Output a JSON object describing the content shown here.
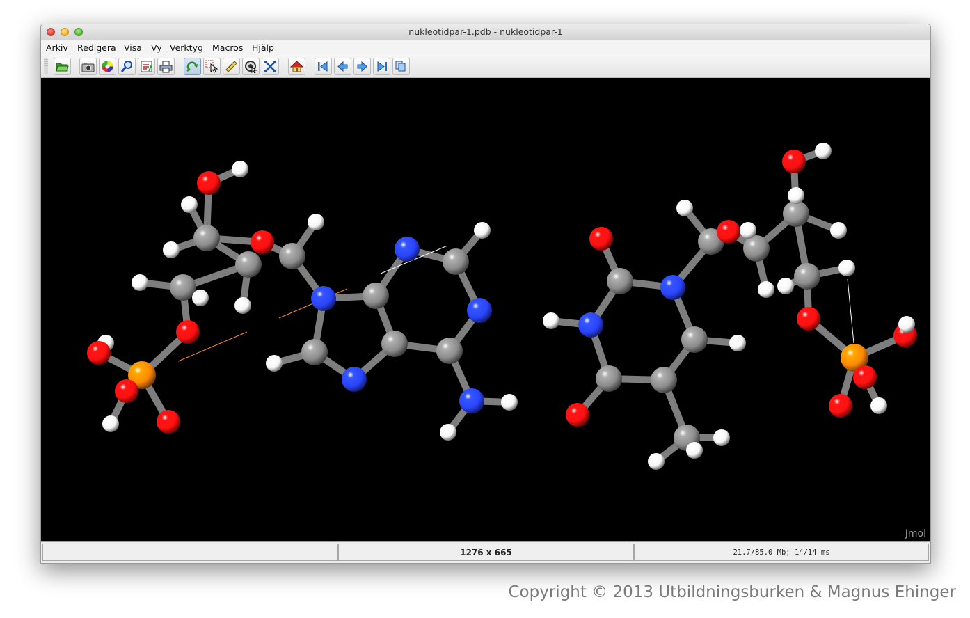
{
  "window": {
    "title": "nukleotidpar-1.pdb - nukleotidpar-1"
  },
  "menubar": {
    "items": [
      {
        "label": "Arkiv"
      },
      {
        "label": "Redigera"
      },
      {
        "label": "Visa"
      },
      {
        "label": "Vy"
      },
      {
        "label": "Verktyg"
      },
      {
        "label": "Macros"
      },
      {
        "label": "Hjälp"
      }
    ]
  },
  "toolbar": {
    "buttons": [
      {
        "icon": "open-folder-icon"
      },
      {
        "icon": "camera-icon"
      },
      {
        "icon": "color-wheel-icon"
      },
      {
        "icon": "magnifier-icon"
      },
      {
        "icon": "script-editor-icon"
      },
      {
        "icon": "print-icon"
      },
      {
        "icon": "rotate-icon",
        "active": true
      },
      {
        "icon": "select-pointer-icon"
      },
      {
        "icon": "ruler-icon"
      },
      {
        "icon": "pick-center-icon"
      },
      {
        "icon": "move-atoms-icon"
      },
      {
        "icon": "home-icon"
      },
      {
        "icon": "first-frame-icon"
      },
      {
        "icon": "previous-frame-icon"
      },
      {
        "icon": "next-frame-icon"
      },
      {
        "icon": "last-frame-icon"
      },
      {
        "icon": "all-frames-icon"
      }
    ]
  },
  "viewer": {
    "watermark": "Jmol",
    "background": "#000000",
    "atom_colors": {
      "carbon": "#8c8c8c",
      "nitrogen": "#2a45ff",
      "oxygen": "#ff1111",
      "hydrogen": "#f5f5f5",
      "phosphorus": "#ff8800"
    }
  },
  "status": {
    "left": "",
    "center": "1276 x 665",
    "right": "21.7/85.0 Mb;  14/14 ms"
  },
  "copyright": "Copyright © 2013 Utbildningsburken & Magnus Ehinger"
}
